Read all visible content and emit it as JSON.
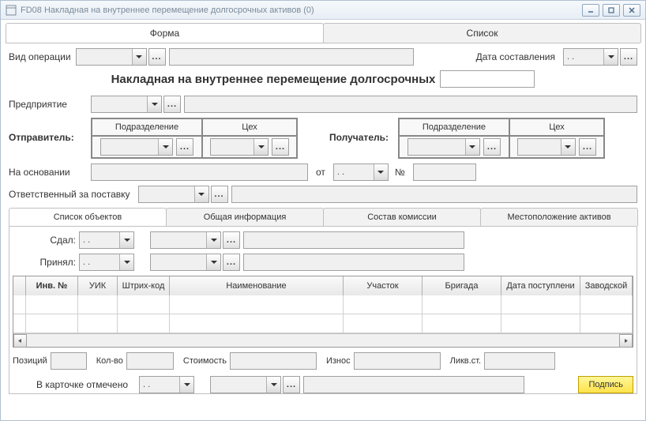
{
  "window": {
    "title": "FD08 Накладная на внутреннее перемещение долгосрочных активов (0)"
  },
  "tabs": {
    "form": "Форма",
    "list": "Список"
  },
  "labels": {
    "operation_type": "Вид операции",
    "doc_date": "Дата составления",
    "heading": "Накладная на внутреннее перемещение долгосрочных",
    "enterprise": "Предприятие",
    "sender": "Отправитель:",
    "receiver": "Получатель:",
    "subdivision": "Подразделение",
    "workshop": "Цех",
    "based_on": "На основании",
    "from_date": "от",
    "number": "№",
    "responsible": "Ответственный за поставку",
    "handed": "Сдал:",
    "received": "Принял:",
    "positions": "Позиций",
    "qty": "Кол-во",
    "cost": "Стоимость",
    "wear": "Износ",
    "salvage": "Ликв.ст.",
    "card_marked": "В карточке отмечено",
    "sign": "Подпись"
  },
  "values": {
    "doc_date": " .  .",
    "from_date": " .  .",
    "handed_date": ". .",
    "received_date": ". .",
    "card_date": " .  ."
  },
  "inner_tabs": {
    "objects": "Список объектов",
    "general": "Общая информация",
    "commission": "Состав комиссии",
    "location": "Местоположение активов"
  },
  "grid_cols": {
    "inv_no": "Инв. №",
    "uik": "УИК",
    "barcode": "Штрих-код",
    "name": "Наименование",
    "area": "Участок",
    "brigade": "Бригада",
    "receipt_date": "Дата поступлени",
    "factory": "Заводской"
  }
}
